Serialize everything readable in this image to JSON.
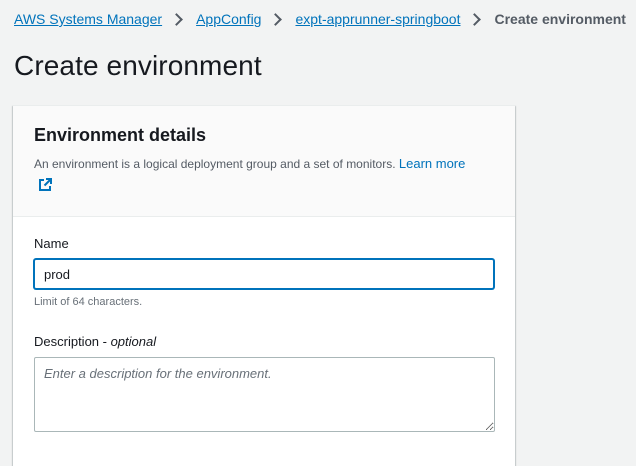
{
  "breadcrumb": {
    "items": [
      {
        "label": "AWS Systems Manager"
      },
      {
        "label": "AppConfig"
      },
      {
        "label": "expt-apprunner-springboot"
      }
    ],
    "current": "Create environment"
  },
  "page": {
    "title": "Create environment"
  },
  "panel": {
    "title": "Environment details",
    "description": "An environment is a logical deployment group and a set of monitors.",
    "learn_more": "Learn more",
    "learn_more_icon": "external-link-icon"
  },
  "name_field": {
    "label": "Name",
    "value": "prod",
    "constraint": "Limit of 64 characters."
  },
  "description_field": {
    "label": "Description - ",
    "label_suffix": "optional",
    "value": "",
    "placeholder": "Enter a description for the environment."
  },
  "colors": {
    "link": "#0073bb",
    "background": "#f2f3f3",
    "focus_border": "#0073bb",
    "text": "#16191f"
  }
}
